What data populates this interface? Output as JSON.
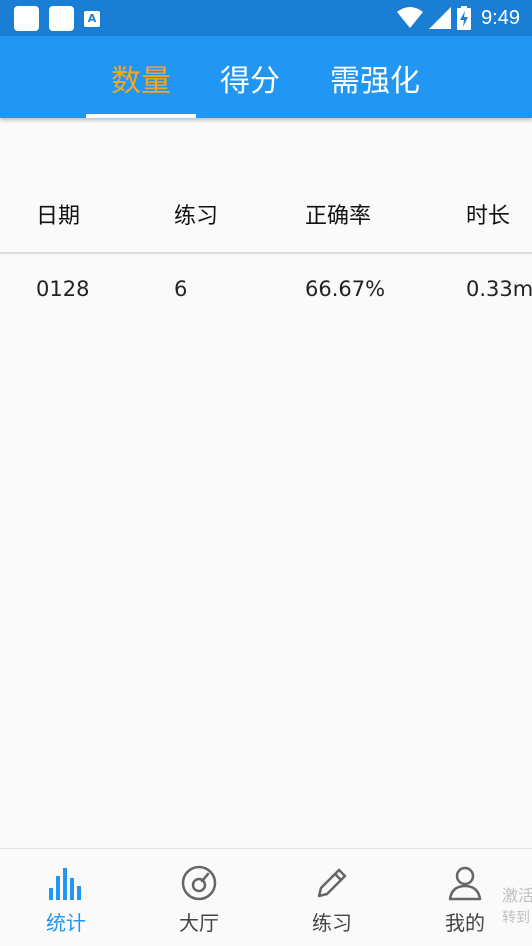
{
  "status_bar": {
    "time": "9:49",
    "icons": [
      "notification-square-icon",
      "notification-square-icon",
      "font-a-icon",
      "wifi-icon",
      "signal-icon",
      "battery-charging-icon"
    ],
    "a_glyph": "A"
  },
  "tabs": [
    {
      "label": "数量",
      "active": true
    },
    {
      "label": "得分",
      "active": false
    },
    {
      "label": "需强化",
      "active": false
    }
  ],
  "table": {
    "headers": [
      "日期",
      "练习",
      "正确率",
      "时长"
    ],
    "rows": [
      [
        "0128",
        "6",
        "66.67%",
        "0.33m"
      ]
    ]
  },
  "bottom_nav": {
    "items": [
      {
        "label": "统计",
        "icon": "bar-chart-icon",
        "active": true
      },
      {
        "label": "大厅",
        "icon": "gauge-icon",
        "active": false
      },
      {
        "label": "练习",
        "icon": "pencil-icon",
        "active": false
      },
      {
        "label": "我的",
        "icon": "person-icon",
        "active": false
      }
    ],
    "overflow_line1": "激活",
    "overflow_line2": "转到"
  },
  "colors": {
    "status_bar_bg": "#1a7fd4",
    "header_bg": "#2196f3",
    "active_tab": "#f5a623",
    "active_nav": "#2196f3"
  }
}
